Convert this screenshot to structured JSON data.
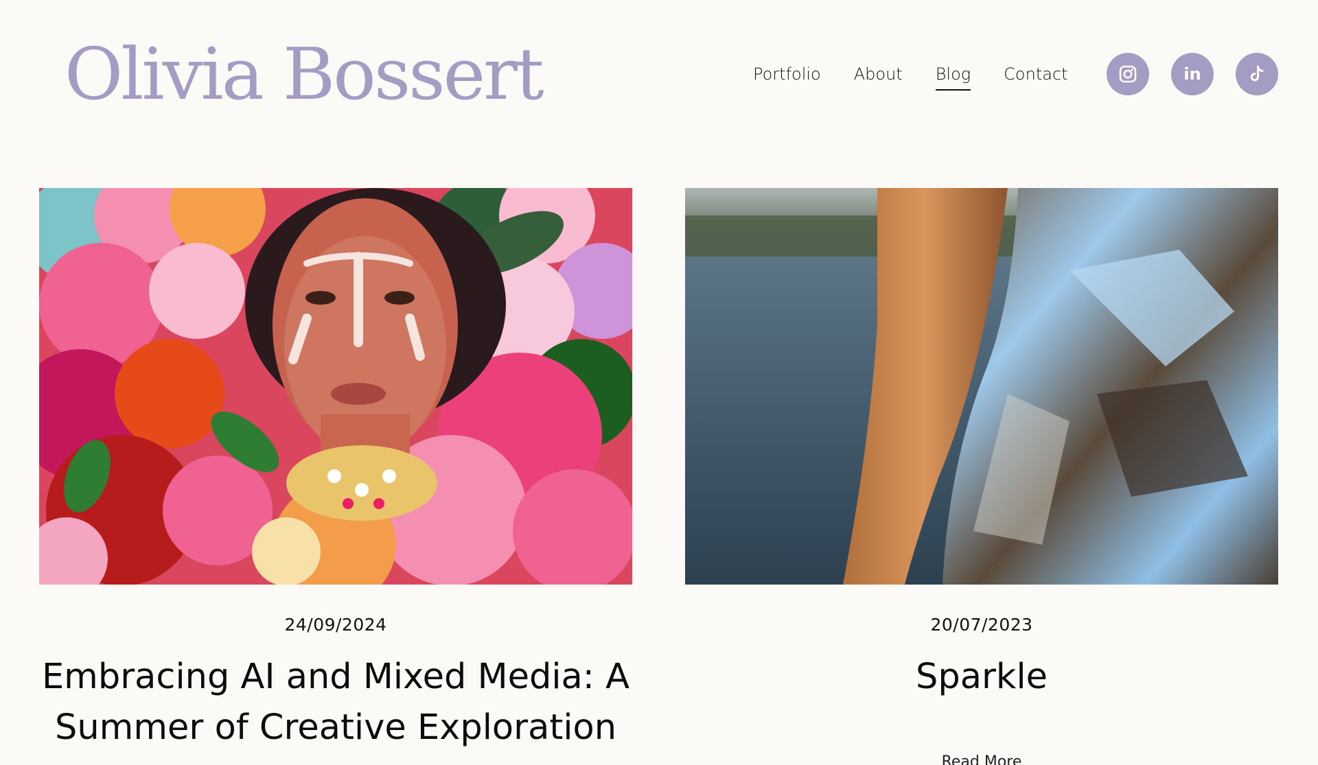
{
  "site": {
    "logo_text": "Olivia Bossert",
    "brand_color": "#a59cc3"
  },
  "nav": {
    "items": [
      {
        "label": "Portfolio",
        "active": false
      },
      {
        "label": "About",
        "active": false
      },
      {
        "label": "Blog",
        "active": true
      },
      {
        "label": "Contact",
        "active": false
      }
    ]
  },
  "social": {
    "items": [
      {
        "icon": "instagram-icon"
      },
      {
        "icon": "linkedin-icon",
        "glyph": "in"
      },
      {
        "icon": "tiktok-icon"
      }
    ]
  },
  "posts": [
    {
      "date": "24/09/2024",
      "title": "Embracing AI and Mixed Media: A Summer of Creative Exploration",
      "image": "portrait-with-flowers"
    },
    {
      "date": "20/07/2023",
      "title": "Sparkle",
      "image": "sequin-dress-by-sea",
      "read_more": "Read More"
    }
  ]
}
